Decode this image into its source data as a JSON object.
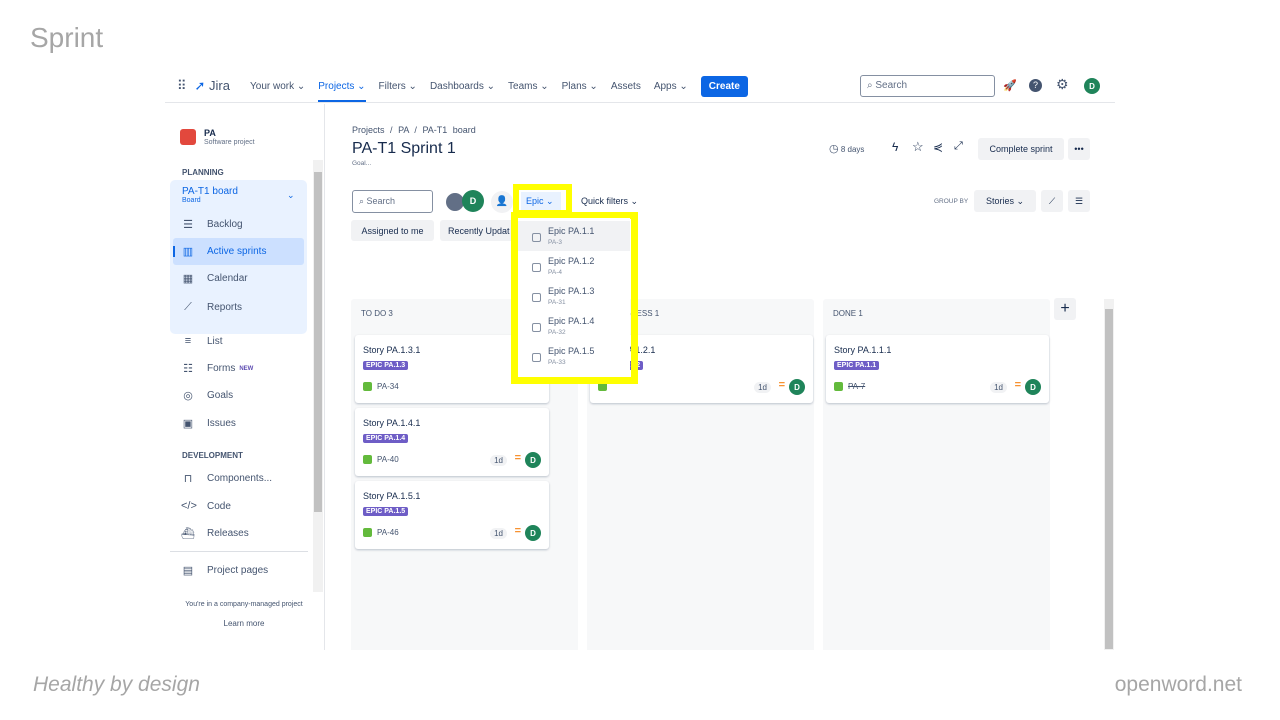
{
  "slide": {
    "title": "Sprint",
    "footer_left": "Healthy by design",
    "footer_right": "openword.net"
  },
  "nav": {
    "app": "Jira",
    "items": [
      "Your work ⌄",
      "Projects ⌄",
      "Filters ⌄",
      "Dashboards ⌄",
      "Teams ⌄",
      "Plans ⌄",
      "Assets",
      "Apps ⌄"
    ],
    "active": "Projects",
    "create": "Create",
    "search_placeholder": "Search",
    "avatar": "D"
  },
  "sidebar": {
    "project": "PA",
    "project_type": "Software project",
    "planning": "PLANNING",
    "board": "PA-T1 board",
    "board_sub": "Board",
    "items": [
      "Backlog",
      "Active sprints",
      "Calendar",
      "Reports",
      "List",
      "Forms",
      "Goals",
      "Issues"
    ],
    "new_badge": "NEW",
    "development": "DEVELOPMENT",
    "dev_items": [
      "Components...",
      "Code",
      "Releases"
    ],
    "project_pages": "Project pages",
    "footer": "You're in a company-managed project",
    "learn_more": "Learn more"
  },
  "main": {
    "breadcrumb": [
      "Projects",
      "/",
      "PA",
      "/",
      "PA-T1 board"
    ],
    "title": "PA-T1 Sprint 1",
    "goal": "Goal...",
    "days": "8 days",
    "complete": "Complete sprint",
    "more": "•••",
    "search_placeholder": "Search",
    "avatar": "D",
    "epic": "Epic",
    "quick_filters": "Quick filters",
    "assigned": "Assigned to me",
    "recent": "Recently Updat",
    "group_by": "GROUP BY",
    "group_value": "Stories"
  },
  "columns": [
    {
      "title": "TO DO 3",
      "cards": [
        {
          "title": "Story PA.1.3.1",
          "epic": "EPIC PA.1.3",
          "key": "PA-34",
          "est": "",
          "avatar": ""
        },
        {
          "title": "Story PA.1.4.1",
          "epic": "EPIC PA.1.4",
          "key": "PA-40",
          "est": "1d",
          "avatar": "D"
        },
        {
          "title": "Story PA.1.5.1",
          "epic": "EPIC PA.1.5",
          "key": "PA-46",
          "est": "1d",
          "avatar": "D"
        }
      ]
    },
    {
      "title": "IN PROGRESS 1",
      "cards": [
        {
          "title": "Story PA.1.2.1",
          "epic": "EPIC PA.1.2",
          "key": "",
          "est": "1d",
          "avatar": "D"
        }
      ]
    },
    {
      "title": "DONE 1",
      "cards": [
        {
          "title": "Story PA.1.1.1",
          "epic": "EPIC PA.1.1",
          "key": "PA-7",
          "est": "1d",
          "avatar": "D"
        }
      ]
    }
  ],
  "epic_dropdown": [
    {
      "label": "Epic PA.1.1",
      "key": "PA-3"
    },
    {
      "label": "Epic PA.1.2",
      "key": "PA-4"
    },
    {
      "label": "Epic PA.1.3",
      "key": "PA-31"
    },
    {
      "label": "Epic PA.1.4",
      "key": "PA-32"
    },
    {
      "label": "Epic PA.1.5",
      "key": "PA-33"
    }
  ],
  "colors": {
    "accent": "#0c66e4",
    "highlight": "#ffff00",
    "epic": "#6e5dc6",
    "avatar": "#1f845a"
  }
}
